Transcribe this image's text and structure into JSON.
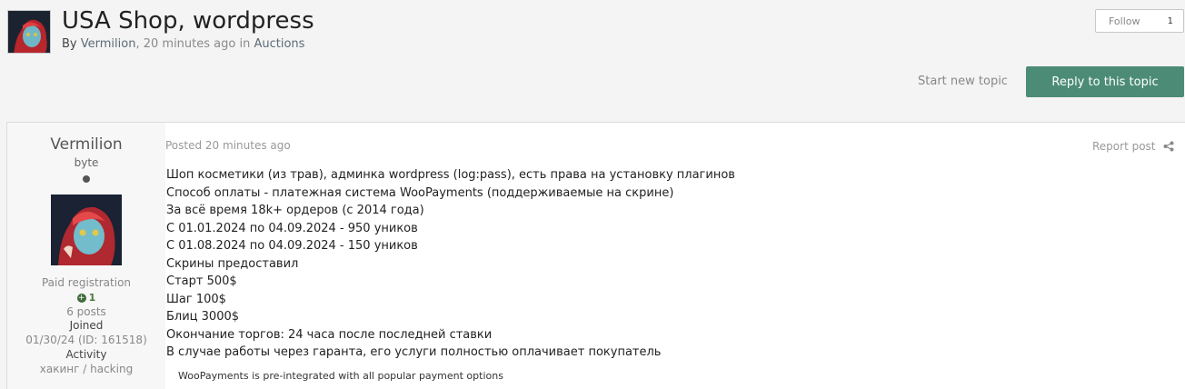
{
  "header": {
    "title": "USA Shop, wordpress",
    "by": "By",
    "author": "Vermilion",
    "time": "20 minutes ago",
    "in": "in",
    "forum": "Auctions"
  },
  "follow": {
    "label": "Follow",
    "count": "1"
  },
  "actions": {
    "start_new_topic": "Start new topic",
    "reply": "Reply to this topic"
  },
  "post": {
    "author": {
      "name": "Vermilion",
      "rank": "byte",
      "group": "Paid registration",
      "reputation": "1",
      "posts": "6 posts",
      "joined_label": "Joined",
      "joined_value": "01/30/24 (ID: 161518)",
      "activity_label": "Activity",
      "activity_value": "хакинг / hacking"
    },
    "posted": "Posted 20 minutes ago",
    "report": "Report post",
    "lines": [
      "Шоп косметики (из трав), админка wordpress (log:pass), есть права на установку плагинов",
      "Способ оплаты - платежная система WooPayments (поддерживаемые на скрине)",
      "За всё время 18k+ ордеров (с 2014 года)",
      "С 01.01.2024 по 04.09.2024 - 950 уников",
      "С 01.08.2024 по 04.09.2024 - 150 уников",
      "Скрины предоставил",
      "Старт 500$",
      "Шаг 100$",
      "Блиц 3000$",
      "Окончание торгов: 24 часа после последней ставки",
      "В случае работы через гаранта, его услуги полностью оплачивает покупатель"
    ],
    "image_caption": "WooPayments is pre-integrated with all popular payment options"
  },
  "colors": {
    "accent": "#4c8c77",
    "link": "#5a6b78",
    "reputation": "#3f6b3a"
  }
}
